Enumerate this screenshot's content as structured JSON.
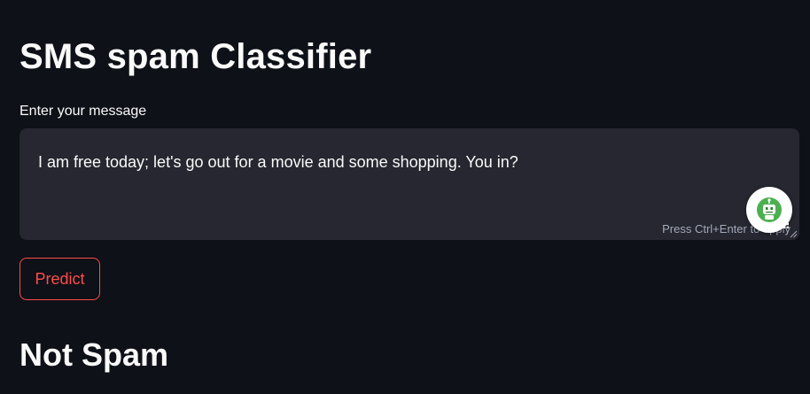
{
  "app": {
    "title": "SMS spam Classifier"
  },
  "form": {
    "label": "Enter your message",
    "message_value": "I am free today; let's go out for a movie and some shopping. You in?",
    "hint": "Press Ctrl+Enter to apply",
    "predict_label": "Predict"
  },
  "result": {
    "text": "Not Spam"
  },
  "icons": {
    "assistant": "robot-icon",
    "keys": "grid-icon",
    "resize": "resize-handle-icon"
  },
  "colors": {
    "background": "#0e1117",
    "input_background": "#262730",
    "accent": "#ff4b4b",
    "text": "#fafafa",
    "hint": "#a3a8b8",
    "bot": "#4caf50"
  }
}
